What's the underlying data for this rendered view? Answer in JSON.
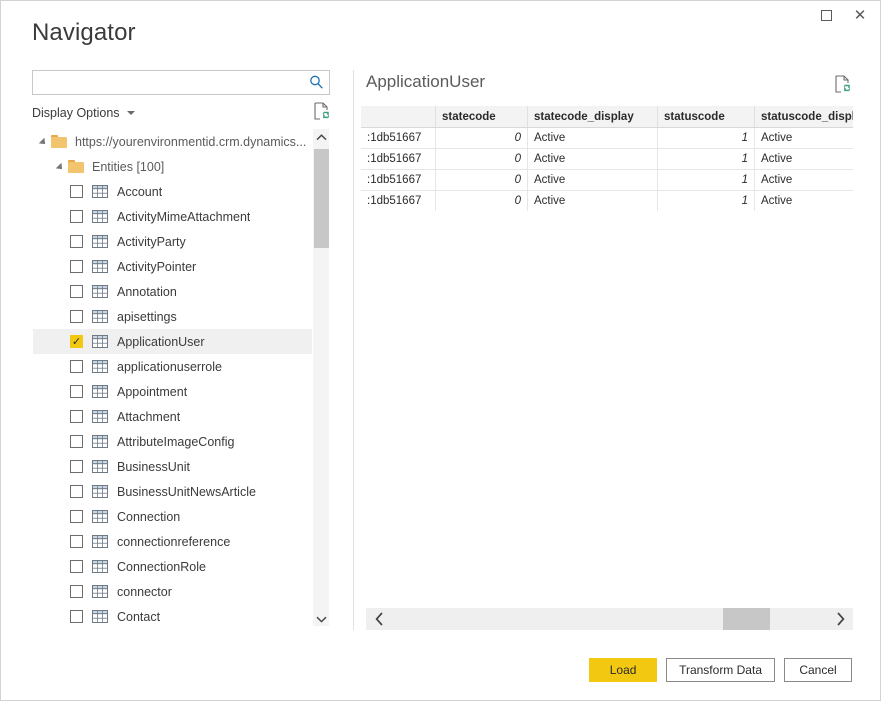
{
  "window": {
    "title": "Navigator",
    "controls": [
      {
        "name": "maximize-button",
        "label": "Maximize"
      },
      {
        "name": "close-button",
        "label": "Close"
      }
    ]
  },
  "search": {
    "value": "",
    "placeholder": "",
    "icon": "search-icon"
  },
  "display_options": {
    "label": "Display Options",
    "caret_icon": "chevron-down-icon",
    "refresh_icon": "refresh-document-icon"
  },
  "tree": {
    "nodes": [
      {
        "label": "https://yourenvironmentid.crm.dynamics...",
        "type": "folder",
        "depth": 0,
        "expanded": true
      },
      {
        "label": "Entities [100]",
        "type": "folder",
        "depth": 1,
        "expanded": true
      },
      {
        "label": "Account",
        "type": "table",
        "depth": 2,
        "checked": false,
        "selected": false
      },
      {
        "label": "ActivityMimeAttachment",
        "type": "table",
        "depth": 2,
        "checked": false,
        "selected": false
      },
      {
        "label": "ActivityParty",
        "type": "table",
        "depth": 2,
        "checked": false,
        "selected": false
      },
      {
        "label": "ActivityPointer",
        "type": "table",
        "depth": 2,
        "checked": false,
        "selected": false
      },
      {
        "label": "Annotation",
        "type": "table",
        "depth": 2,
        "checked": false,
        "selected": false
      },
      {
        "label": "apisettings",
        "type": "table",
        "depth": 2,
        "checked": false,
        "selected": false
      },
      {
        "label": "ApplicationUser",
        "type": "table",
        "depth": 2,
        "checked": true,
        "selected": true
      },
      {
        "label": "applicationuserrole",
        "type": "table",
        "depth": 2,
        "checked": false,
        "selected": false
      },
      {
        "label": "Appointment",
        "type": "table",
        "depth": 2,
        "checked": false,
        "selected": false
      },
      {
        "label": "Attachment",
        "type": "table",
        "depth": 2,
        "checked": false,
        "selected": false
      },
      {
        "label": "AttributeImageConfig",
        "type": "table",
        "depth": 2,
        "checked": false,
        "selected": false
      },
      {
        "label": "BusinessUnit",
        "type": "table",
        "depth": 2,
        "checked": false,
        "selected": false
      },
      {
        "label": "BusinessUnitNewsArticle",
        "type": "table",
        "depth": 2,
        "checked": false,
        "selected": false
      },
      {
        "label": "Connection",
        "type": "table",
        "depth": 2,
        "checked": false,
        "selected": false
      },
      {
        "label": "connectionreference",
        "type": "table",
        "depth": 2,
        "checked": false,
        "selected": false
      },
      {
        "label": "ConnectionRole",
        "type": "table",
        "depth": 2,
        "checked": false,
        "selected": false
      },
      {
        "label": "connector",
        "type": "table",
        "depth": 2,
        "checked": false,
        "selected": false
      },
      {
        "label": "Contact",
        "type": "table",
        "depth": 2,
        "checked": false,
        "selected": false
      }
    ],
    "scrollbar": {
      "up_arrow": "chevron-up-icon",
      "down_arrow": "chevron-down-icon"
    }
  },
  "preview": {
    "title": "ApplicationUser",
    "refresh_icon": "refresh-document-icon",
    "columns": [
      "",
      "statecode",
      "statecode_display",
      "statuscode",
      "statuscode_display"
    ],
    "rows": [
      [
        ":1db51667",
        "0",
        "Active",
        "1",
        "Active"
      ],
      [
        ":1db51667",
        "0",
        "Active",
        "1",
        "Active"
      ],
      [
        ":1db51667",
        "0",
        "Active",
        "1",
        "Active"
      ],
      [
        ":1db51667",
        "0",
        "Active",
        "1",
        "Active"
      ]
    ],
    "hscroll": {
      "left_arrow": "chevron-left-icon",
      "right_arrow": "chevron-right-icon"
    }
  },
  "footer": {
    "load_label": "Load",
    "transform_label": "Transform Data",
    "cancel_label": "Cancel"
  },
  "colors": {
    "accent": "#f2c811",
    "header_bg": "#f3f3f3",
    "selection_bg": "#f0f0f0",
    "scrollbar_thumb": "#c7c7c7"
  }
}
